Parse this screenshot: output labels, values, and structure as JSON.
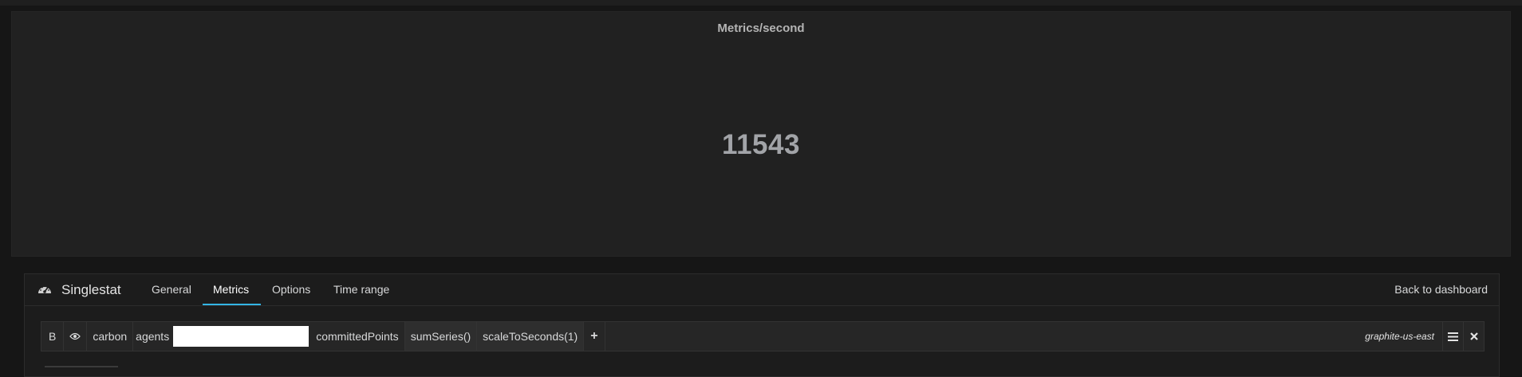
{
  "panel": {
    "title": "Metrics/second",
    "value": "11543"
  },
  "editor": {
    "title": "Singlestat",
    "icon": "speedometer-icon",
    "tabs": [
      {
        "label": "General",
        "active": false
      },
      {
        "label": "Metrics",
        "active": true
      },
      {
        "label": "Options",
        "active": false
      },
      {
        "label": "Time range",
        "active": false
      }
    ],
    "back_link": "Back to dashboard"
  },
  "query": {
    "ref": "B",
    "visibility_icon": "eye-icon",
    "segments": [
      "carbon",
      "agents",
      "committedPoints"
    ],
    "functions": [
      "sumSeries()",
      "scaleToSeconds(1)"
    ],
    "add_icon": "plus-icon",
    "datasource": "graphite-us-east",
    "menu_icon": "hamburger-icon",
    "remove_icon": "close-icon"
  },
  "colors": {
    "background": "#161616",
    "panel": "#212121",
    "accent": "#33b5e5"
  }
}
